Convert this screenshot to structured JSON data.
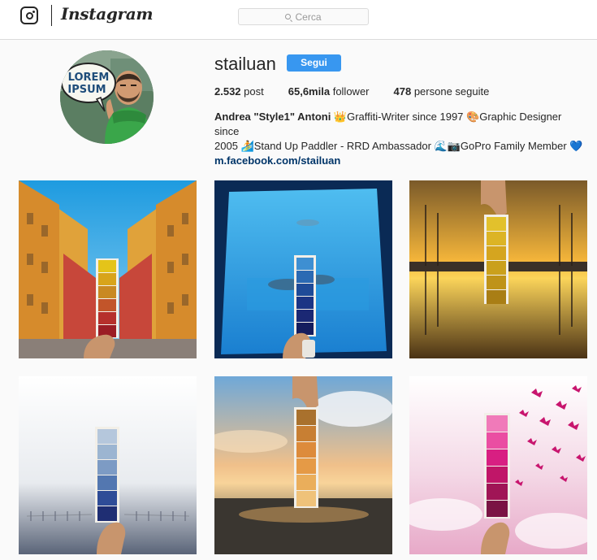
{
  "header": {
    "logo_icon": "instagram-camera-icon",
    "wordmark": "Instagram",
    "search": {
      "placeholder": "Cerca",
      "icon": "search-icon"
    }
  },
  "profile": {
    "username": "stailuan",
    "follow_label": "Segui",
    "avatar_sign_text": [
      "LOREM",
      "IPSUM"
    ],
    "stats": [
      {
        "count": "2.532",
        "label": "post"
      },
      {
        "count": "65,6mila",
        "label": "follower"
      },
      {
        "count": "478",
        "label": "persone seguite"
      }
    ],
    "bio": {
      "name": "Andrea \"Style1\" Antoni",
      "line1_rest": " 👑Graffiti-Writer since 1997 🎨Graphic Designer since",
      "line2": "2005 🏄Stand Up Paddler - RRD Ambassador 🌊📷GoPro Family Member 💙",
      "link": "m.facebook.com/stailuan"
    }
  },
  "posts": [
    {
      "name": "post-street-palette",
      "swatches": [
        "#e4c419",
        "#d8a41a",
        "#c98922",
        "#c2552a",
        "#b6302c",
        "#9b1d25"
      ]
    },
    {
      "name": "post-aquarium-palette",
      "swatches": [
        "#3e8fd2",
        "#2b6ab3",
        "#1f4b98",
        "#1c3585",
        "#1b2874",
        "#151d5e"
      ]
    },
    {
      "name": "post-sunset-harbour-palette",
      "swatches": [
        "#e2c12c",
        "#dcb425",
        "#d5a51f",
        "#caa01c",
        "#bf9319",
        "#a97e15"
      ]
    },
    {
      "name": "post-foggy-pier-palette",
      "swatches": [
        "#b5c7dc",
        "#9cb5d1",
        "#7d9bc4",
        "#5377b0",
        "#2f4c97",
        "#1f2e73"
      ]
    },
    {
      "name": "post-beach-sunset-palette",
      "swatches": [
        "#a9712d",
        "#c87f33",
        "#dd8b3b",
        "#e59a46",
        "#eaae5b",
        "#efc27a"
      ]
    },
    {
      "name": "post-butterflies-palette",
      "swatches": [
        "#f07ab9",
        "#ea4ea2",
        "#d81f82",
        "#c01668",
        "#a01556",
        "#7a1444"
      ]
    }
  ]
}
